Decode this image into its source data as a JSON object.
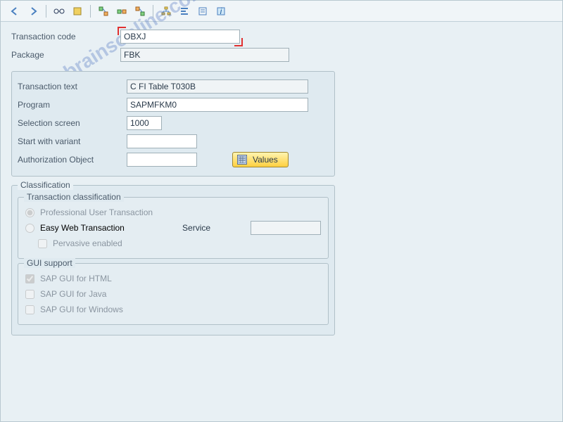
{
  "toolbar": {
    "icons": [
      "back",
      "forward",
      "display",
      "execute",
      "hierarchy",
      "where-used",
      "transport",
      "org",
      "align",
      "filter",
      "info"
    ]
  },
  "header": {
    "tcode_label": "Transaction code",
    "tcode_value": "OBXJ",
    "package_label": "Package",
    "package_value": "FBK"
  },
  "details": {
    "text_label": "Transaction text",
    "text_value": "C FI Table T030B",
    "program_label": "Program",
    "program_value": "SAPMFKM0",
    "selscreen_label": "Selection screen",
    "selscreen_value": "1000",
    "variant_label": "Start with variant",
    "variant_value": "",
    "authobj_label": "Authorization Object",
    "authobj_value": "",
    "values_btn": "Values"
  },
  "classification": {
    "group_title": "Classification",
    "subgroup_title": "Transaction classification",
    "radio_prof": "Professional User Transaction",
    "radio_easy": "Easy Web Transaction",
    "service_label": "Service",
    "service_value": "",
    "check_pervasive": "Pervasive enabled",
    "gui_title": "GUI support",
    "gui_html": "SAP GUI for HTML",
    "gui_java": "SAP GUI for Java",
    "gui_win": "SAP GUI for Windows"
  },
  "watermark": "sapbrainsonline.com"
}
